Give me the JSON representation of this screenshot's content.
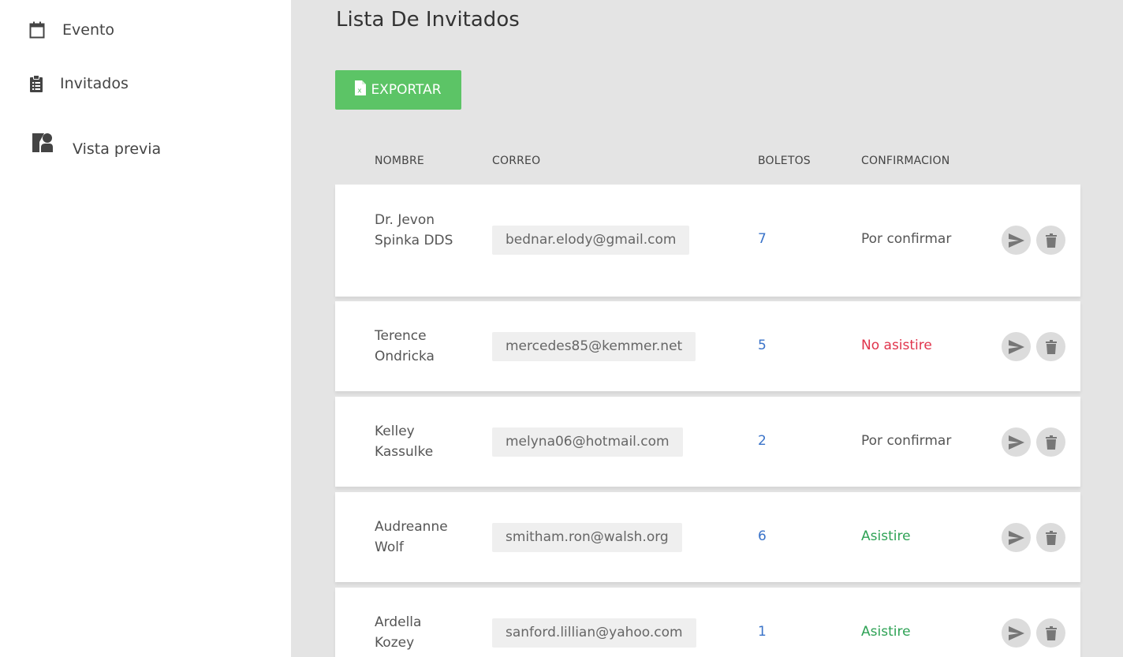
{
  "sidebar": {
    "items": [
      {
        "label": "Evento",
        "icon": "calendar-icon"
      },
      {
        "label": "Invitados",
        "icon": "clipboard-list-icon"
      },
      {
        "label": "Vista previa",
        "icon": "preview-person-icon"
      }
    ]
  },
  "main": {
    "title": "Lista De Invitados",
    "export_label": "EXPORTAR",
    "export_icon": "excel-file-icon",
    "columns": {
      "nombre": "NOMBRE",
      "correo": "CORREO",
      "boletos": "BOLETOS",
      "confirmacion": "CONFIRMACION"
    },
    "guests": [
      {
        "name": "Dr. Jevon Spinka DDS",
        "email": "bednar.elody@gmail.com",
        "tickets": "7",
        "status": "Por confirmar"
      },
      {
        "name": "Terence Ondricka",
        "email": "mercedes85@kemmer.net",
        "tickets": "5",
        "status": "No asistire"
      },
      {
        "name": "Kelley Kassulke",
        "email": "melyna06@hotmail.com",
        "tickets": "2",
        "status": "Por confirmar"
      },
      {
        "name": "Audreanne Wolf",
        "email": "smitham.ron@walsh.org",
        "tickets": "6",
        "status": "Asistire"
      },
      {
        "name": "Ardella Kozey",
        "email": "sanford.lillian@yahoo.com",
        "tickets": "1",
        "status": "Asistire"
      }
    ],
    "row_actions": {
      "send_icon": "send-icon",
      "delete_icon": "trash-icon"
    }
  },
  "colors": {
    "export_button": "#5cc466",
    "tickets": "#3a73c9",
    "status_no": "#e0334b",
    "status_yes": "#2ea255",
    "main_background": "#e4e4e4"
  }
}
